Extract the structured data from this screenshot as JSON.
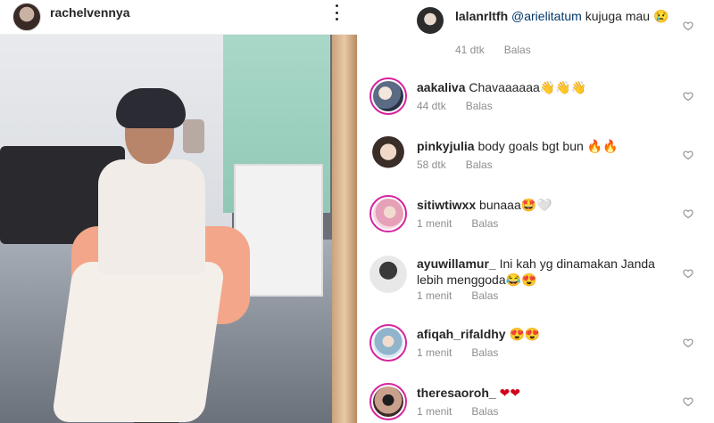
{
  "post": {
    "username": "rachelvennya"
  },
  "comments": [
    {
      "username": "lalanrltfh",
      "mention": "@arielitatum",
      "text": " kujuga mau 😢",
      "time": "41 dtk",
      "reply": "Balas"
    },
    {
      "username": "aakaliva",
      "mention": "",
      "text": " Chavaaaaaa👋👋👋",
      "time": "44 dtk",
      "reply": "Balas"
    },
    {
      "username": "pinkyjulia",
      "mention": "",
      "text": " body goals bgt bun 🔥🔥",
      "time": "58 dtk",
      "reply": "Balas"
    },
    {
      "username": "sitiwtiwxx",
      "mention": "",
      "text": " bunaaa🤩🤍",
      "time": "1 menit",
      "reply": "Balas"
    },
    {
      "username": "ayuwillamur_",
      "mention": "",
      "text": " Ini kah yg dinamakan Janda lebih menggoda😂😍",
      "time": "1 menit",
      "reply": "Balas"
    },
    {
      "username": "afiqah_rifaldhy",
      "mention": "",
      "text": " 😍😍",
      "time": "1 menit",
      "reply": "Balas"
    },
    {
      "username": "theresaoroh_",
      "mention": "",
      "text": " ❤❤",
      "time": "1 menit",
      "reply": "Balas"
    }
  ],
  "colors": {
    "username": "#262626",
    "mention": "#00376b",
    "meta": "#8e8e8e",
    "story_ring": "#d6249f"
  },
  "icons": {
    "more": "kebab-menu-icon",
    "like": "heart-outline-icon"
  }
}
